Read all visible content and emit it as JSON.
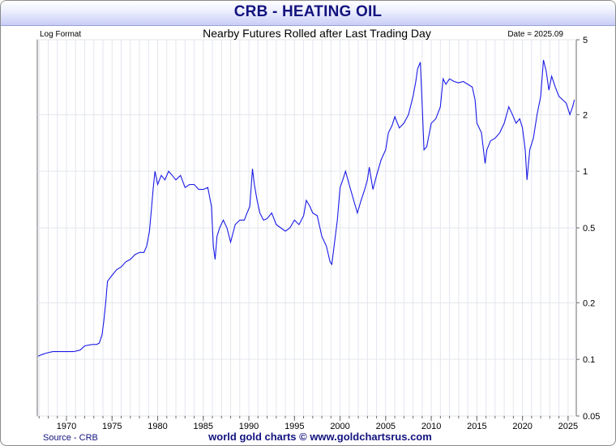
{
  "title": "CRB - HEATING OIL",
  "format_label": "Log Format",
  "subtitle": "Nearby Futures Rolled after Last Trading Day",
  "date_label": "Date = 2025.09",
  "source": "Source - CRB",
  "credit": "world gold charts © www.goldchartsrus.com",
  "colors": {
    "line": "#1a1ae6",
    "title": "#13137f",
    "grid": "#e3e6ee",
    "text": "#13137f"
  },
  "chart_data": {
    "type": "line",
    "log_scale": true,
    "xlim": [
      1966.8,
      2025.9
    ],
    "ylim": [
      0.05,
      5
    ],
    "y_ticks": [
      0.05,
      0.1,
      0.2,
      0.5,
      1,
      2,
      5
    ],
    "y_tick_labels": [
      "0.05",
      "0.1",
      "0.2",
      "0.5",
      "1",
      "2",
      "5"
    ],
    "x_ticks": [
      1970,
      1975,
      1980,
      1985,
      1990,
      1995,
      2000,
      2005,
      2010,
      2015,
      2020,
      2025
    ],
    "x_tick_labels": [
      "1970",
      "1975",
      "1980",
      "1985",
      "1990",
      "1995",
      "2000",
      "2005",
      "2010",
      "2015",
      "2020",
      "2025"
    ],
    "series": [
      {
        "x": [
          1966.9,
          1967.3,
          1967.8,
          1968.5,
          1969.2,
          1970.0,
          1970.8,
          1971.5,
          1972.0,
          1972.8,
          1973.3,
          1973.6,
          1973.9,
          1974.1,
          1974.3,
          1974.5,
          1975.0,
          1975.5,
          1976.0,
          1976.5,
          1977.0,
          1977.5,
          1978.0,
          1978.5,
          1978.8,
          1979.1,
          1979.3,
          1979.5,
          1979.7,
          1980.0,
          1980.4,
          1980.8,
          1981.2,
          1981.6,
          1982.0,
          1982.5,
          1983.0,
          1983.5,
          1984.0,
          1984.5,
          1985.0,
          1985.5,
          1985.9,
          1986.1,
          1986.3,
          1986.5,
          1986.8,
          1987.2,
          1987.6,
          1988.0,
          1988.5,
          1989.0,
          1989.5,
          1989.8,
          1990.1,
          1990.4,
          1990.6,
          1990.9,
          1991.2,
          1991.6,
          1992.0,
          1992.5,
          1993.0,
          1993.5,
          1994.0,
          1994.5,
          1995.0,
          1995.5,
          1996.0,
          1996.3,
          1996.7,
          1997.0,
          1997.5,
          1998.0,
          1998.5,
          1998.9,
          1999.1,
          1999.4,
          1999.7,
          2000.0,
          2000.3,
          2000.6,
          2001.0,
          2001.5,
          2001.9,
          2002.3,
          2002.7,
          2003.0,
          2003.2,
          2003.6,
          2004.0,
          2004.5,
          2005.0,
          2005.3,
          2005.7,
          2006.0,
          2006.5,
          2007.0,
          2007.5,
          2008.0,
          2008.3,
          2008.5,
          2008.8,
          2009.0,
          2009.2,
          2009.5,
          2010.0,
          2010.5,
          2011.0,
          2011.3,
          2011.6,
          2012.0,
          2012.5,
          2013.0,
          2013.5,
          2014.0,
          2014.5,
          2014.8,
          2015.0,
          2015.5,
          2015.9,
          2016.1,
          2016.5,
          2017.0,
          2017.5,
          2018.0,
          2018.5,
          2018.9,
          2019.3,
          2019.7,
          2020.0,
          2020.3,
          2020.5,
          2020.8,
          2021.2,
          2021.6,
          2022.0,
          2022.3,
          2022.6,
          2022.9,
          2023.2,
          2023.6,
          2024.0,
          2024.4,
          2024.8,
          2025.2,
          2025.5,
          2025.7
        ],
        "y": [
          0.104,
          0.106,
          0.108,
          0.11,
          0.11,
          0.11,
          0.11,
          0.112,
          0.118,
          0.12,
          0.12,
          0.122,
          0.135,
          0.16,
          0.2,
          0.26,
          0.28,
          0.3,
          0.31,
          0.33,
          0.34,
          0.36,
          0.37,
          0.37,
          0.4,
          0.48,
          0.62,
          0.8,
          1.0,
          0.85,
          0.95,
          0.9,
          1.0,
          0.95,
          0.9,
          0.95,
          0.82,
          0.85,
          0.85,
          0.8,
          0.8,
          0.82,
          0.65,
          0.4,
          0.34,
          0.45,
          0.5,
          0.55,
          0.5,
          0.42,
          0.52,
          0.55,
          0.55,
          0.6,
          0.65,
          1.03,
          0.85,
          0.7,
          0.6,
          0.55,
          0.56,
          0.6,
          0.52,
          0.5,
          0.48,
          0.5,
          0.55,
          0.52,
          0.58,
          0.7,
          0.65,
          0.6,
          0.58,
          0.45,
          0.4,
          0.33,
          0.32,
          0.42,
          0.55,
          0.82,
          0.9,
          1.0,
          0.85,
          0.7,
          0.6,
          0.7,
          0.8,
          0.9,
          1.05,
          0.8,
          0.95,
          1.15,
          1.3,
          1.6,
          1.75,
          1.95,
          1.7,
          1.8,
          2.0,
          2.5,
          3.0,
          3.5,
          3.8,
          2.3,
          1.3,
          1.35,
          1.8,
          1.9,
          2.2,
          3.1,
          2.9,
          3.1,
          3.0,
          2.95,
          3.0,
          2.9,
          2.8,
          2.4,
          1.8,
          1.6,
          1.1,
          1.3,
          1.45,
          1.5,
          1.6,
          1.8,
          2.2,
          2.0,
          1.8,
          1.9,
          1.7,
          1.3,
          0.9,
          1.3,
          1.5,
          2.0,
          2.5,
          3.9,
          3.4,
          2.7,
          3.2,
          2.8,
          2.5,
          2.4,
          2.3,
          2.0,
          2.2,
          2.4
        ]
      }
    ]
  }
}
